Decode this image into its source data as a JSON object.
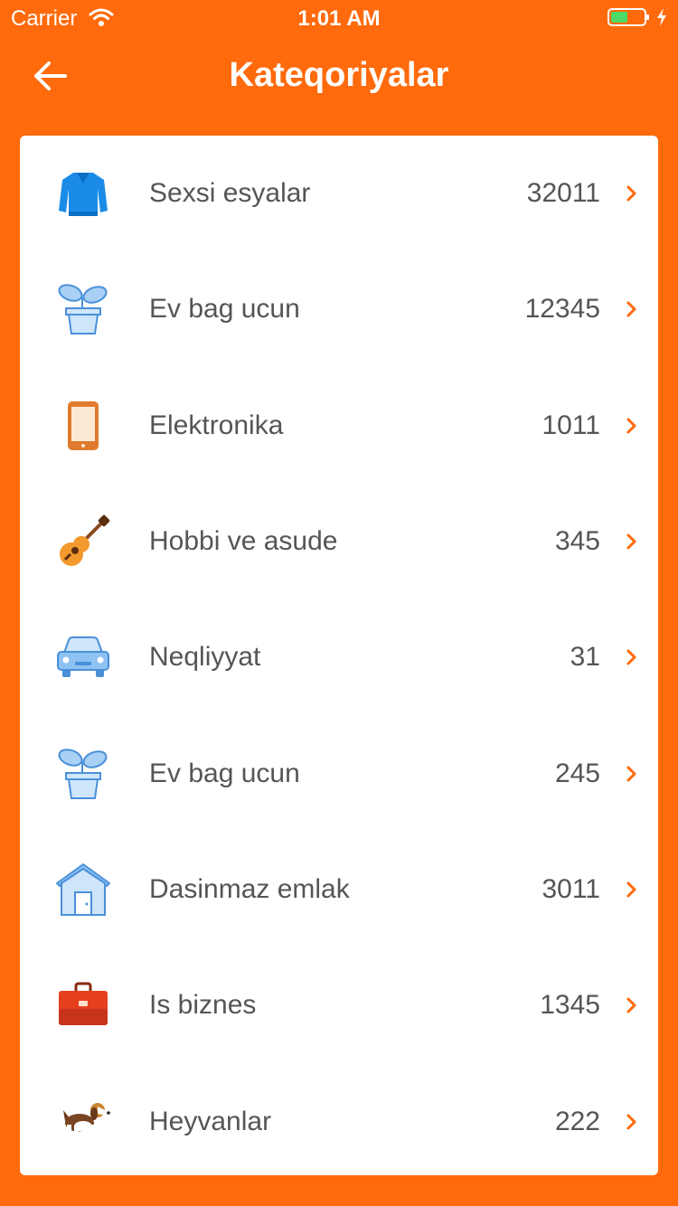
{
  "status": {
    "carrier": "Carrier",
    "time": "1:01 AM"
  },
  "header": {
    "title": "Kateqoriyalar"
  },
  "colors": {
    "accent": "#ff6a0c",
    "text": "#555555",
    "chevron": "#ff6a0c"
  },
  "categories": [
    {
      "label": "Sexsi esyalar",
      "count": "32011",
      "icon": "sweater-icon"
    },
    {
      "label": "Ev bag ucun",
      "count": "12345",
      "icon": "plant-pot-icon"
    },
    {
      "label": "Elektronika",
      "count": "1011",
      "icon": "phone-icon"
    },
    {
      "label": "Hobbi ve asude",
      "count": "345",
      "icon": "guitar-icon"
    },
    {
      "label": "Neqliyyat",
      "count": "31",
      "icon": "car-icon"
    },
    {
      "label": "Ev bag ucun",
      "count": "245",
      "icon": "plant-pot-icon"
    },
    {
      "label": "Dasinmaz emlak",
      "count": "3011",
      "icon": "house-icon"
    },
    {
      "label": "Is biznes",
      "count": "1345",
      "icon": "briefcase-icon"
    },
    {
      "label": "Heyvanlar",
      "count": "222",
      "icon": "dog-icon"
    }
  ]
}
